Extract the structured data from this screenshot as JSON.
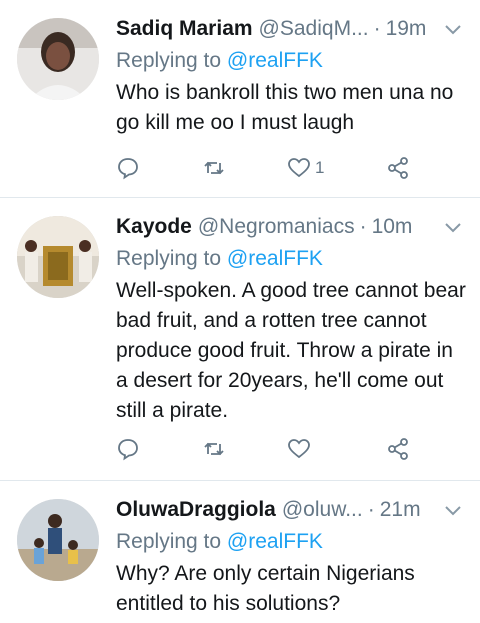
{
  "tweets": [
    {
      "name": "Sadiq Mariam",
      "handle": "@SadiqM...",
      "time": "19m",
      "replying_prefix": "Replying to",
      "replying_to": "@realFFK",
      "text": "Who is bankroll this two men una no go kill me oo I must laugh",
      "like_count": "1"
    },
    {
      "name": "Kayode",
      "handle": "@Negromaniacs",
      "time": "10m",
      "replying_prefix": "Replying to",
      "replying_to": "@realFFK",
      "text": "Well-spoken. A good tree cannot bear bad fruit, and a rotten tree cannot produce good fruit. Throw a pirate in a desert for 20years, he'll come out still a pirate.",
      "like_count": ""
    },
    {
      "name": "OluwaDraggiola",
      "handle": "@oluw...",
      "time": "21m",
      "replying_prefix": "Replying to",
      "replying_to": "@realFFK",
      "text": "Why? Are only certain Nigerians entitled to his solutions?",
      "like_count": ""
    }
  ],
  "colors": {
    "link": "#1da1f2",
    "muted": "#657786",
    "text": "#14171a",
    "divider": "#e1e8ed"
  },
  "icons": [
    "chevron-down-icon",
    "reply-icon",
    "retweet-icon",
    "like-icon",
    "share-icon"
  ]
}
